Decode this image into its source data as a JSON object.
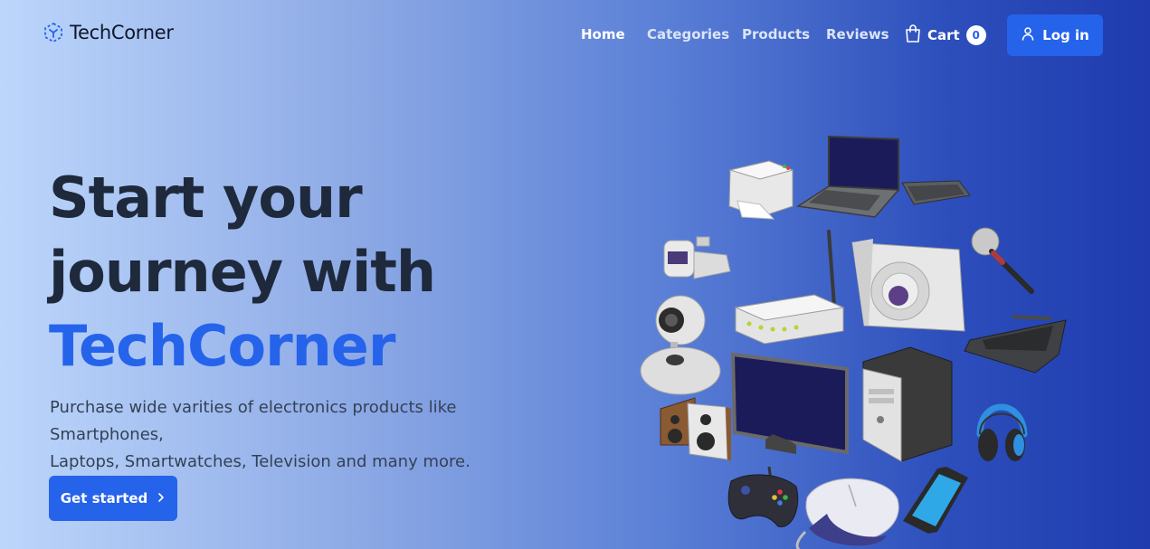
{
  "brand": {
    "name": "TechCorner",
    "logo_icon": "dotted-cube-icon"
  },
  "nav": {
    "items": [
      {
        "label": "Home",
        "active": true
      },
      {
        "label": "Categories",
        "active": false
      },
      {
        "label": "Products",
        "active": false
      },
      {
        "label": "Reviews",
        "active": false
      }
    ],
    "cart": {
      "label": "Cart",
      "count": "0",
      "icon": "shopping-bag-icon"
    },
    "login": {
      "label": "Log in",
      "icon": "user-icon"
    }
  },
  "hero": {
    "title_line1": "Start your",
    "title_line2": "journey with",
    "title_accent": "TechCorner",
    "subtitle_line1": "Purchase wide varities of electronics products like Smartphones,",
    "subtitle_line2": "Laptops, Smartwatches, Television and many more.",
    "cta_label": "Get started",
    "cta_icon": "chevron-right-icon"
  },
  "colors": {
    "accent": "#2563eb",
    "heading": "#1e293b",
    "gradient_start": "#bcd6fb",
    "gradient_end": "#1f3bae"
  },
  "illustration": {
    "items": [
      "printer",
      "laptop",
      "keyboard",
      "camcorder",
      "wifi-router",
      "digital-camera",
      "microphone",
      "webcam",
      "graphics-tablet",
      "monitor",
      "desktop-tower",
      "speakers",
      "headphones",
      "gamepad",
      "computer-mouse",
      "smartphone"
    ]
  }
}
